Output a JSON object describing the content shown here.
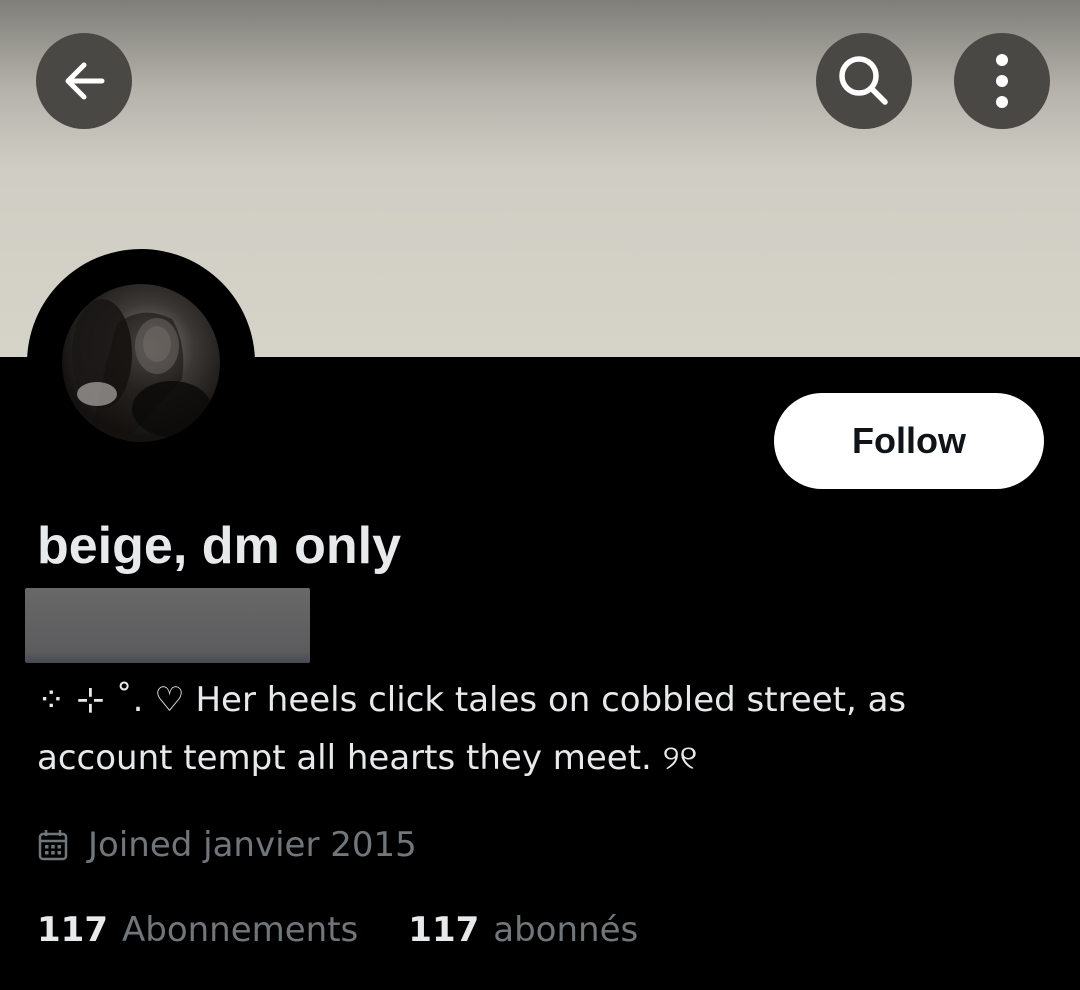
{
  "header": {
    "back_icon": "arrow-left-icon",
    "search_icon": "search-icon",
    "more_icon": "more-vertical-icon"
  },
  "profile": {
    "display_name": "beige, dm only",
    "follow_label": "Follow",
    "bio": "⁘  ⊹ ˚. ♡  Her heels click tales on cobbled street, as account tempt all hearts they meet.  ୨୧",
    "joined": "Joined janvier 2015",
    "joined_icon": "calendar-icon"
  },
  "stats": {
    "following_count": "117",
    "following_label": "Abonnements",
    "followers_count": "117",
    "followers_label": "abonnés"
  },
  "colors": {
    "background": "#000000",
    "button_overlay": "#4a4844",
    "primary_text": "#e7e9ea",
    "secondary_text": "#71767b",
    "follow_button": "#ffffff"
  }
}
